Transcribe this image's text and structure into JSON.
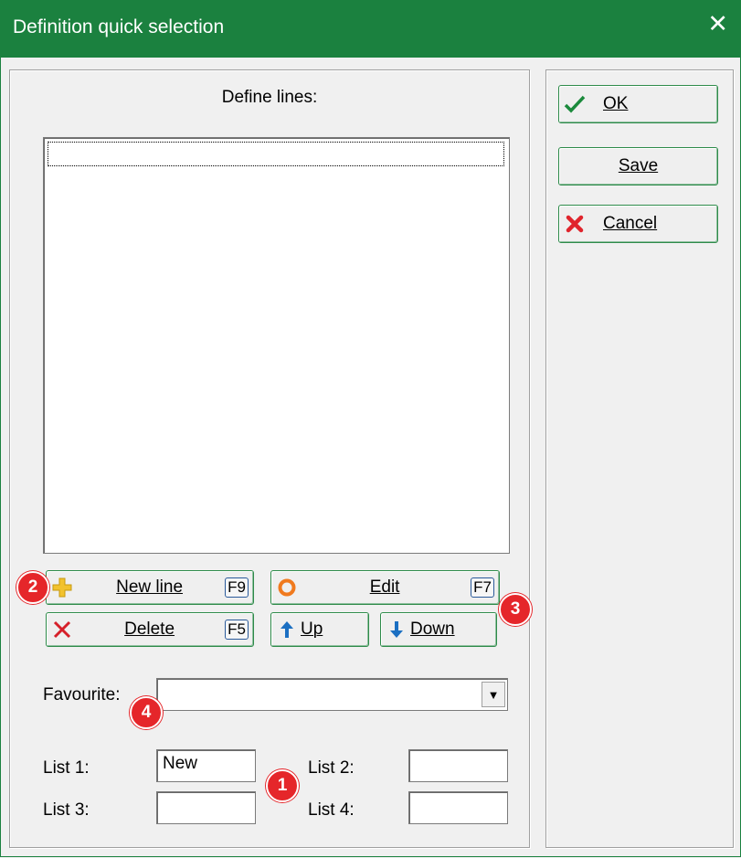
{
  "window": {
    "title": "Definition quick selection",
    "close_glyph": "✕"
  },
  "define_lines": {
    "label": "Define lines:",
    "items": []
  },
  "buttons": {
    "new_line": {
      "label": "New line",
      "key": "F9",
      "icon": "plus-icon"
    },
    "edit": {
      "label": "Edit",
      "key": "F7",
      "icon": "edit-ring-icon"
    },
    "delete": {
      "label": "Delete",
      "key": "F5",
      "icon": "delete-x-icon"
    },
    "up": {
      "label": "Up",
      "icon": "arrow-up-icon"
    },
    "down": {
      "label": "Down",
      "icon": "arrow-down-icon"
    }
  },
  "favourite": {
    "label": "Favourite:",
    "value": ""
  },
  "lists": {
    "list1": {
      "label": "List 1:",
      "value": "New"
    },
    "list2": {
      "label": "List 2:",
      "value": ""
    },
    "list3": {
      "label": "List 3:",
      "value": ""
    },
    "list4": {
      "label": "List 4:",
      "value": ""
    }
  },
  "actions": {
    "ok": {
      "label": "OK",
      "icon": "checkmark-icon"
    },
    "save": {
      "label": "Save"
    },
    "cancel": {
      "label": "Cancel",
      "icon": "cancel-x-icon"
    }
  },
  "badges": {
    "b1": "1",
    "b2": "2",
    "b3": "3",
    "b4": "4"
  },
  "colors": {
    "titlebar": "#1b813f",
    "badge": "#e5262a",
    "button_border": "#2e8b4a"
  }
}
